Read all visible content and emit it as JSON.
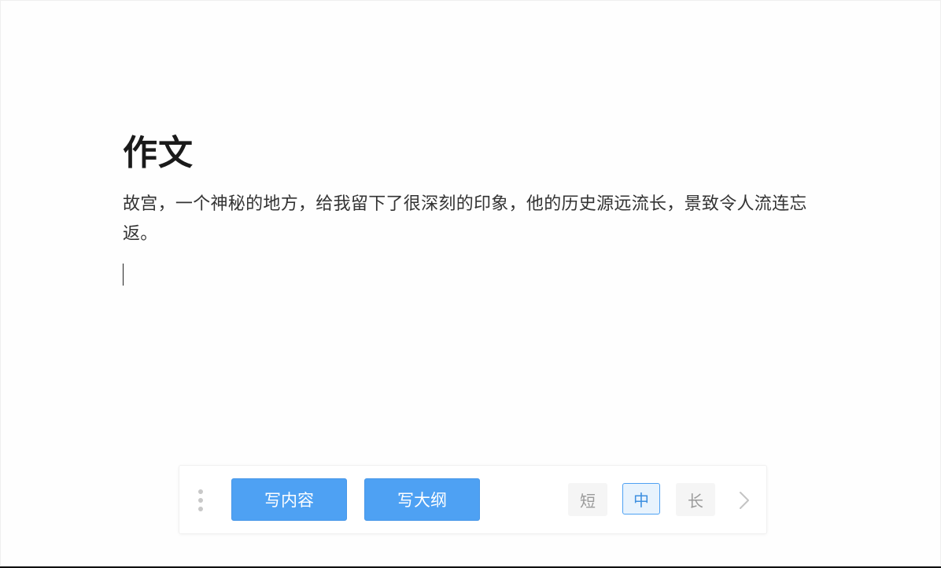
{
  "document": {
    "title": "作文",
    "body": "故宫，一个神秘的地方，给我留下了很深刻的印象，他的历史源远流长，景致令人流连忘返。"
  },
  "toolbar": {
    "write_content_label": "写内容",
    "write_outline_label": "写大纲",
    "length_options": {
      "short": "短",
      "medium": "中",
      "long": "长"
    },
    "selected_length": "中",
    "accent_color": "#4ea1f3"
  },
  "icons": {
    "drag_handle": "drag-handle-icon",
    "next": "chevron-right-icon"
  }
}
